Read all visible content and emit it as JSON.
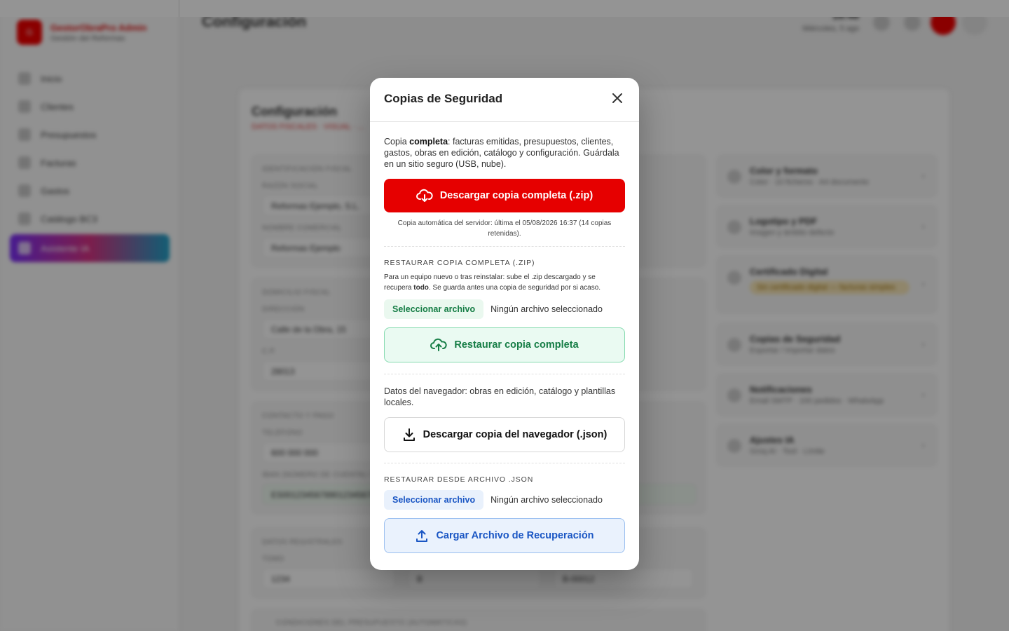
{
  "app": {
    "brand_name": "GestorObraPro Admin",
    "brand_sub": "Gestión del Reformas",
    "brand_logo": "G",
    "nav": [
      {
        "label": "Inicio"
      },
      {
        "label": "Clientes"
      },
      {
        "label": "Presupuestos"
      },
      {
        "label": "Facturas"
      },
      {
        "label": "Gastos"
      },
      {
        "label": "Catálogo BC3"
      },
      {
        "label": "Asistente IA"
      }
    ],
    "page_title": "Configuración",
    "clock_time": "18:48",
    "clock_date": "Miércoles, 5 ago",
    "card_title": "Configuración",
    "card_subtitle": "DATOS FISCALES · VISUAL · ...",
    "sections": [
      {
        "label": "IDENTIFICACIÓN FISCAL",
        "field_label": "RAZÓN SOCIAL",
        "field_value": "Reformas Ejemplo, S.L.",
        "field2_label": "NOMBRE COMERCIAL",
        "field2_value": "Reformas Ejemplo"
      },
      {
        "label": "DOMICILIO FISCAL",
        "field_label": "DIRECCIÓN",
        "field_value": "Calle de la Obra, 15",
        "field2_label": "C.P.",
        "field2_value": "28013"
      },
      {
        "label": "CONTACTO Y PAGO",
        "field_label": "TELÉFONO",
        "field_value": "600 000 000",
        "field2_label": "IBAN (NÚMERO DE CUENTA) / BIC",
        "field2_value": "ES0012345678901234567890"
      },
      {
        "label": "DATOS REGISTRALES",
        "field_label": "TOMO",
        "field_value": "1234",
        "field2_value": "B",
        "field3_value": "B-00012"
      }
    ],
    "footer_section": "CONDICIONES DEL PRESUPUESTO (AUTOMÁTICAS)",
    "right_cards": [
      {
        "title": "Color y formato",
        "sub": "Color · 10 ficheros · A4 documento"
      },
      {
        "title": "Logotipo y PDF",
        "sub": "Imagen y ámbito defecto"
      },
      {
        "title": "Certificado Digital",
        "sub": "Sin certificado digital — facturas simples"
      },
      {
        "title": "Copias de Seguridad",
        "sub": "Exportar / Importar datos"
      },
      {
        "title": "Notificaciones",
        "sub": "Email SMTP · 100 pedidos · WhatsApp"
      },
      {
        "title": "Ajustes IA",
        "sub": "Groq AI · Tool · Límite"
      }
    ]
  },
  "modal": {
    "title": "Copias de Seguridad",
    "intro_prefix": "Copia ",
    "intro_bold": "completa",
    "intro_rest": ": facturas emitidas, presupuestos, clientes, gastos, obras en edición, catálogo y configuración. Guárdala en un sitio seguro (USB, nube).",
    "download_full_label": "Descargar copia completa (.zip)",
    "server_note": "Copia automática del servidor: última el 05/08/2026 16:37 (14 copias retenidas).",
    "restore_zip_heading": "RESTAURAR COPIA COMPLETA (.ZIP)",
    "restore_zip_text_prefix": "Para un equipo nuevo o tras reinstalar: sube el .zip descargado y se recupera ",
    "restore_zip_text_bold": "todo",
    "restore_zip_text_suffix": ". Se guarda antes una copia de seguridad por si acaso.",
    "select_file_label": "Seleccionar archivo",
    "no_file_label": "Ningún archivo seleccionado",
    "restore_full_label": "Restaurar copia completa",
    "browser_data_text": "Datos del navegador: obras en edición, catálogo y plantillas locales.",
    "download_browser_label": "Descargar copia del navegador (.json)",
    "restore_json_heading": "RESTAURAR DESDE ARCHIVO .JSON",
    "select_file_label_2": "Seleccionar archivo",
    "no_file_label_2": "Ningún archivo seleccionado",
    "load_recovery_label": "Cargar Archivo de Recuperación"
  },
  "colors": {
    "accent_red": "#e60000",
    "green": "#157d45",
    "blue": "#1a56c4"
  },
  "icons": {
    "close": "close-icon",
    "download_cloud": "cloud-download-icon",
    "upload_cloud": "cloud-upload-icon",
    "download": "download-icon",
    "upload": "upload-icon"
  }
}
